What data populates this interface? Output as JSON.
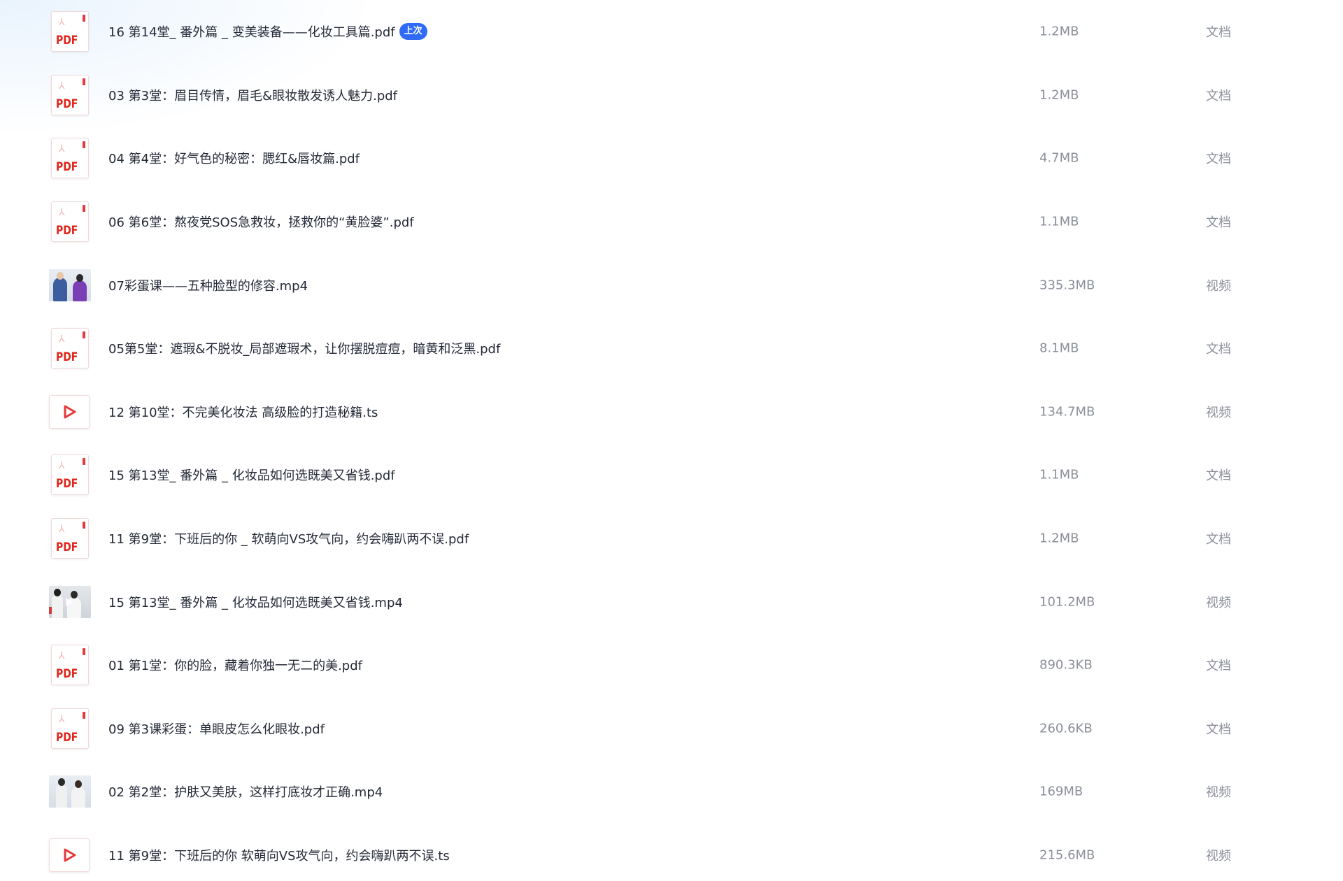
{
  "files": [
    {
      "icon": "pdf-icon",
      "name": "16 第14堂_ 番外篇 _ 变美装备——化妆工具篇.pdf",
      "badge": "上次",
      "size": "1.2MB",
      "type": "文档"
    },
    {
      "icon": "pdf-icon",
      "name": "03 第3堂：眉目传情，眉毛&眼妆散发诱人魅力.pdf",
      "size": "1.2MB",
      "type": "文档"
    },
    {
      "icon": "pdf-icon",
      "name": "04 第4堂：好气色的秘密：腮红&唇妆篇.pdf",
      "size": "4.7MB",
      "type": "文档"
    },
    {
      "icon": "pdf-icon",
      "name": "06 第6堂：熬夜党SOS急救妆，拯救你的“黄脸婆”.pdf",
      "size": "1.1MB",
      "type": "文档"
    },
    {
      "icon": "video-thumbnail",
      "name": "07彩蛋课——五种脸型的修容.mp4",
      "size": "335.3MB",
      "type": "视频"
    },
    {
      "icon": "pdf-icon",
      "name": "05第5堂：遮瑕&不脱妆_局部遮瑕术，让你摆脱痘痘，暗黄和泛黑.pdf",
      "size": "8.1MB",
      "type": "文档"
    },
    {
      "icon": "play-icon",
      "name": "12 第10堂：不完美化妆法  高级脸的打造秘籍.ts",
      "size": "134.7MB",
      "type": "视频"
    },
    {
      "icon": "pdf-icon",
      "name": "15 第13堂_ 番外篇 _ 化妆品如何选既美又省钱.pdf",
      "size": "1.1MB",
      "type": "文档"
    },
    {
      "icon": "pdf-icon",
      "name": "11 第9堂：下班后的你 _ 软萌向VS攻气向，约会嗨趴两不误.pdf",
      "size": "1.2MB",
      "type": "文档"
    },
    {
      "icon": "video-thumbnail",
      "name": "15 第13堂_ 番外篇 _ 化妆品如何选既美又省钱.mp4",
      "size": "101.2MB",
      "type": "视频"
    },
    {
      "icon": "pdf-icon",
      "name": "01 第1堂：你的脸，藏着你独一无二的美.pdf",
      "size": "890.3KB",
      "type": "文档"
    },
    {
      "icon": "pdf-icon",
      "name": "09 第3课彩蛋：单眼皮怎么化眼妆.pdf",
      "size": "260.6KB",
      "type": "文档"
    },
    {
      "icon": "video-thumbnail",
      "name": "02 第2堂：护肤又美肤，这样打底妆才正确.mp4",
      "size": "169MB",
      "type": "视频"
    },
    {
      "icon": "play-icon",
      "name": "11 第9堂：下班后的你  软萌向VS攻气向，约会嗨趴两不误.ts",
      "size": "215.6MB",
      "type": "视频"
    }
  ],
  "pdf_icon_text": "PDF",
  "colors": {
    "pdf_red": "#e1251b",
    "badge_blue": "#2f6bf6",
    "name_text": "#252a37",
    "meta_text": "#8b8f99"
  }
}
